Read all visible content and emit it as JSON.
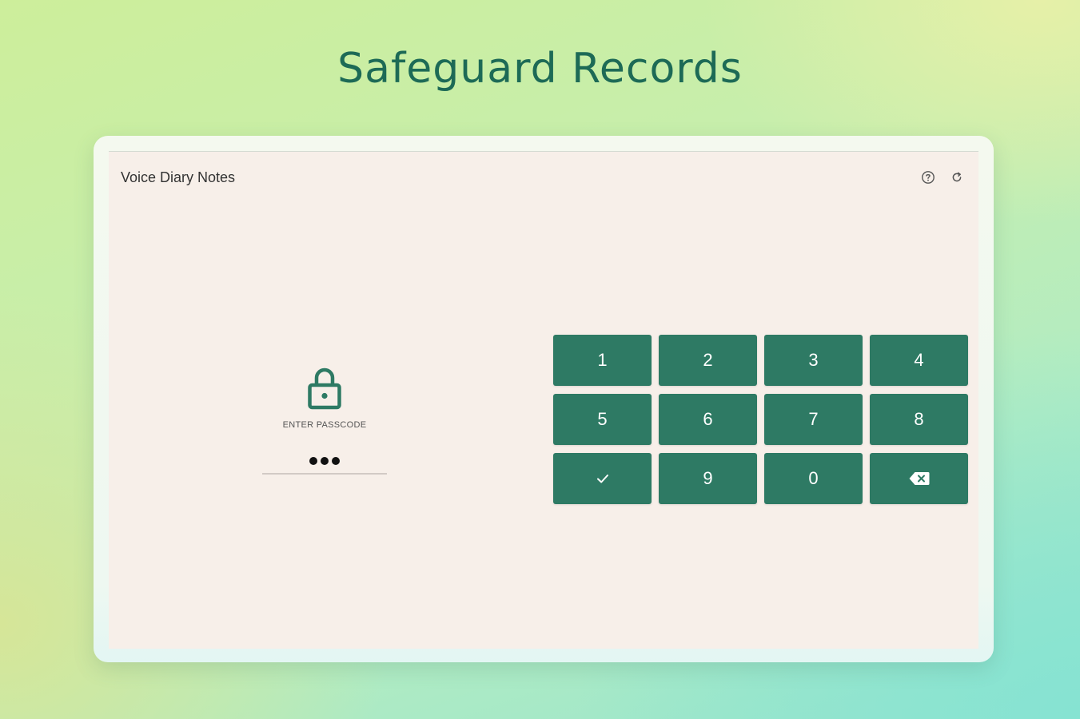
{
  "headline": "Safeguard Records",
  "app": {
    "title": "Voice Diary Notes",
    "icons": [
      "help-icon",
      "refresh-icon"
    ]
  },
  "lock_screen": {
    "icon": "lock-icon",
    "label": "ENTER PASSCODE",
    "entered_digits": 3
  },
  "keypad": {
    "keys": [
      {
        "label": "1",
        "name": "key-1"
      },
      {
        "label": "2",
        "name": "key-2"
      },
      {
        "label": "3",
        "name": "key-3"
      },
      {
        "label": "4",
        "name": "key-4"
      },
      {
        "label": "5",
        "name": "key-5"
      },
      {
        "label": "6",
        "name": "key-6"
      },
      {
        "label": "7",
        "name": "key-7"
      },
      {
        "label": "8",
        "name": "key-8"
      },
      {
        "label": "",
        "name": "key-confirm",
        "icon": "check-icon"
      },
      {
        "label": "9",
        "name": "key-9"
      },
      {
        "label": "0",
        "name": "key-0"
      },
      {
        "label": "",
        "name": "key-backspace",
        "icon": "backspace-icon"
      }
    ]
  },
  "colors": {
    "accent": "#2e7a64",
    "headline": "#1d6a56",
    "screen_bg": "#f7efe9"
  }
}
